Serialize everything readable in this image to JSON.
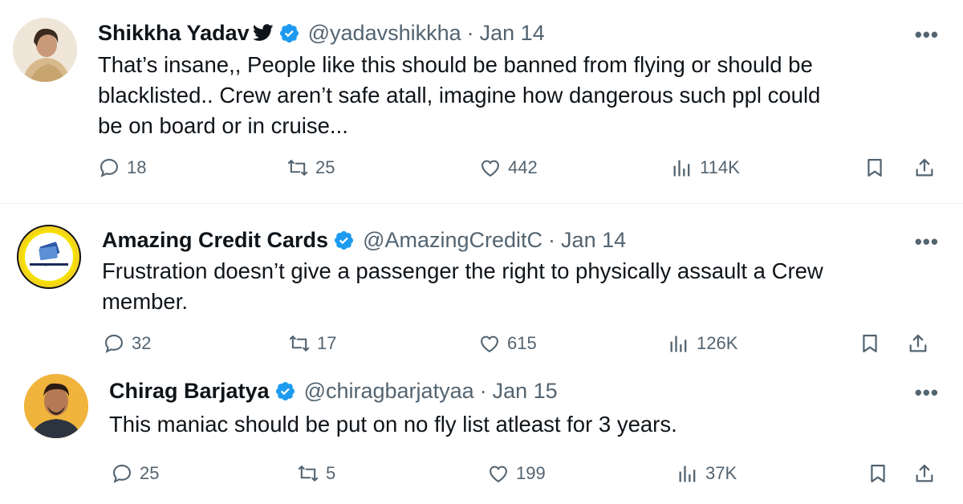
{
  "tweets": [
    {
      "name": "Shikkha Yadav",
      "handle": "@yadavshikkha",
      "separator": "·",
      "date": "Jan 14",
      "more": "•••",
      "text_lines": [
        "That’s insane,, People like this should be banned from flying or should be",
        "blacklisted.. Crew aren’t safe atall, imagine how dangerous such ppl could",
        "be on board or in cruise..."
      ],
      "replies": "18",
      "reposts": "25",
      "likes": "442",
      "views": "114K"
    },
    {
      "name": "Amazing Credit Cards",
      "handle": "@AmazingCreditC",
      "separator": "·",
      "date": "Jan 14",
      "more": "•••",
      "text_lines": [
        "Frustration doesn’t give a passenger the right to physically assault a Crew",
        "member."
      ],
      "replies": "32",
      "reposts": "17",
      "likes": "615",
      "views": "126K",
      "logo_text": "Amazing Credit Cards"
    },
    {
      "name": "Chirag Barjatya",
      "handle": "@chiragbarjatyaa",
      "separator": "·",
      "date": "Jan 15",
      "more": "•••",
      "text_lines": [
        "This maniac should be put on no fly list atleast for 3 years."
      ],
      "replies": "25",
      "reposts": "5",
      "likes": "199",
      "views": "37K"
    }
  ],
  "colors": {
    "text": "#0f1419",
    "secondary": "#536471",
    "verified": "#1d9bf0",
    "divider": "#eff3f4"
  },
  "icons": [
    "twitter-bird-icon",
    "verified-badge-icon",
    "more-icon",
    "reply-icon",
    "repost-icon",
    "like-icon",
    "views-icon",
    "bookmark-icon",
    "share-icon"
  ]
}
